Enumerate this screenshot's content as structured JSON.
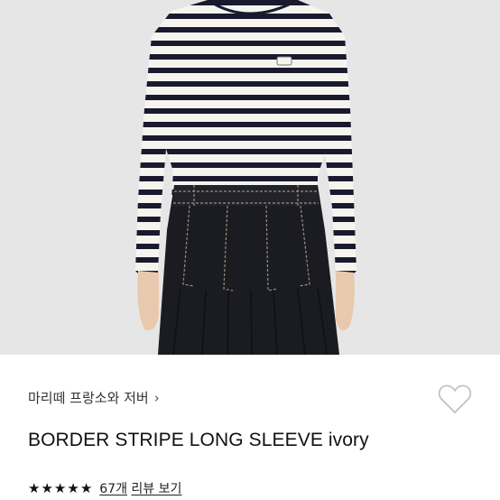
{
  "product": {
    "brand_label": "마리떼 프랑소와 저버",
    "brand_chevron": "›",
    "title": "BORDER STRIPE LONG SLEEVE ivory",
    "rating": 5,
    "stars": [
      "★",
      "★",
      "★",
      "★",
      "★"
    ],
    "review_count": "67개",
    "review_label": "리뷰 보기"
  },
  "icons": {
    "wish": "heart-outline-icon",
    "star": "star-icon"
  },
  "colors": {
    "stripe": "#1a1a2e",
    "shirt": "#f6f4ef",
    "skirt": "#1b1c22",
    "stitch": "#9a8f7a",
    "background": "#e6e6e6"
  }
}
